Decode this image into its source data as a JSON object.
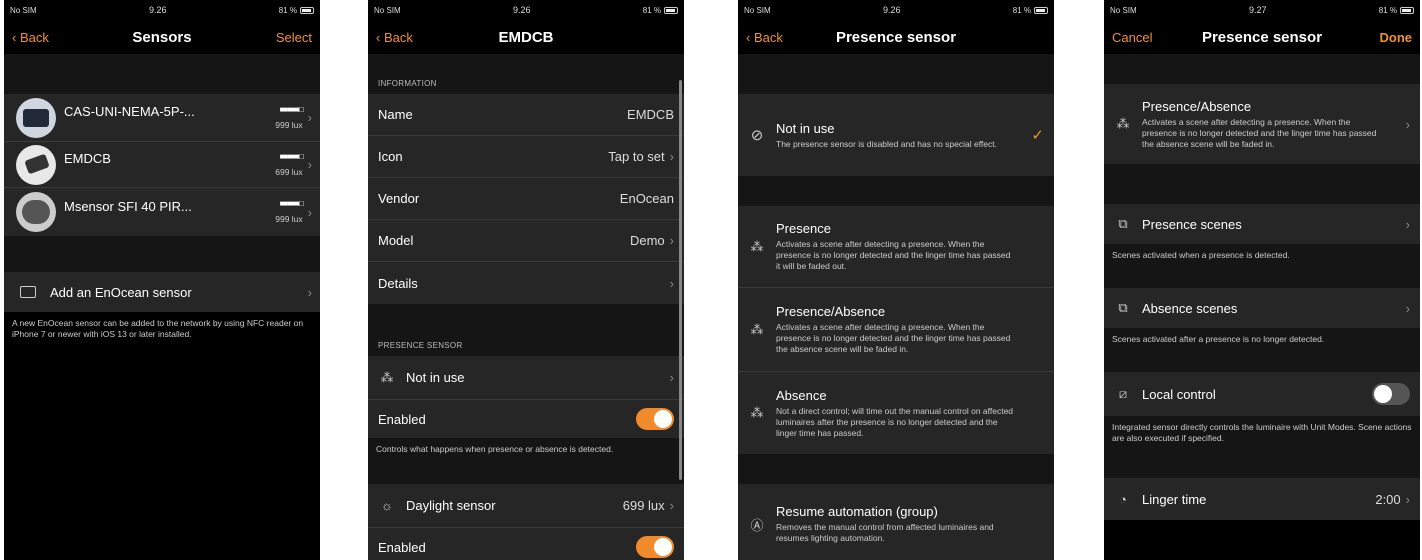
{
  "status": {
    "carrier": "No SIM",
    "battery": "81 %"
  },
  "s1": {
    "time": "9.26",
    "nav": {
      "back": "Back",
      "title": "Sensors",
      "right": "Select"
    },
    "devices": [
      {
        "name": "CAS-UNI-NEMA-5P-...",
        "signal": "■■■■■□",
        "lux": "999 lux"
      },
      {
        "name": "EMDCB",
        "signal": "■■■■■□",
        "lux": "699 lux"
      },
      {
        "name": "Msensor SFI 40 PIR...",
        "signal": "■■■■■□",
        "lux": "999 lux"
      }
    ],
    "add_label": "Add an EnOcean sensor",
    "footer": "A new EnOcean sensor can be added to the network by using NFC reader on iPhone 7 or newer with iOS 13 or later installed."
  },
  "s2": {
    "time": "9.26",
    "nav": {
      "back": "Back",
      "title": "EMDCB"
    },
    "info_header": "INFORMATION",
    "info": [
      {
        "label": "Name",
        "value": "EMDCB",
        "chev": false
      },
      {
        "label": "Icon",
        "value": "Tap to set",
        "chev": true
      },
      {
        "label": "Vendor",
        "value": "EnOcean",
        "chev": false
      },
      {
        "label": "Model",
        "value": "Demo",
        "chev": true
      },
      {
        "label": "Details",
        "value": "",
        "chev": true
      }
    ],
    "presence_header": "PRESENCE SENSOR",
    "presence_value": "Not in use",
    "enabled_label": "Enabled",
    "presence_footer": "Controls what happens when presence or absence is detected.",
    "daylight_label": "Daylight sensor",
    "daylight_value": "699 lux",
    "enabled2_label": "Enabled"
  },
  "s3": {
    "time": "9.26",
    "nav": {
      "back": "Back",
      "title": "Presence sensor"
    },
    "not_in_use": {
      "title": "Not in use",
      "desc": "The presence sensor is disabled and has no special effect.",
      "check": "✓"
    },
    "options": [
      {
        "title": "Presence",
        "desc": "Activates a scene after detecting a presence. When the presence is no longer detected and the linger time has passed it will be faded out."
      },
      {
        "title": "Presence/Absence",
        "desc": "Activates a scene after detecting a presence. When the presence is no longer detected and the linger time has passed the absence scene will be faded in."
      },
      {
        "title": "Absence",
        "desc": "Not a direct control; will time out the manual control on affected luminaires after the presence is no longer detected and the linger time has passed."
      }
    ],
    "resume": {
      "title": "Resume automation (group)",
      "desc": "Removes the manual control from affected luminaires and resumes lighting automation."
    }
  },
  "s4": {
    "time": "9.27",
    "nav": {
      "cancel": "Cancel",
      "title": "Presence sensor",
      "done": "Done"
    },
    "mode": {
      "title": "Presence/Absence",
      "desc": "Activates a scene after detecting a presence. When the presence is no longer detected and the linger time has passed the absence scene will be faded in."
    },
    "presence_scenes": "Presence scenes",
    "presence_scenes_footer": "Scenes activated when a presence is detected.",
    "absence_scenes": "Absence scenes",
    "absence_scenes_footer": "Scenes activated after a presence is no longer detected.",
    "local_control": "Local control",
    "local_control_footer": "Integrated sensor directly controls the luminaire with Unit Modes. Scene actions are also executed if specified.",
    "linger_label": "Linger time",
    "linger_value": "2:00"
  },
  "colors": {
    "accent": "#f0922e",
    "cell": "#262626",
    "background": "#000000"
  }
}
